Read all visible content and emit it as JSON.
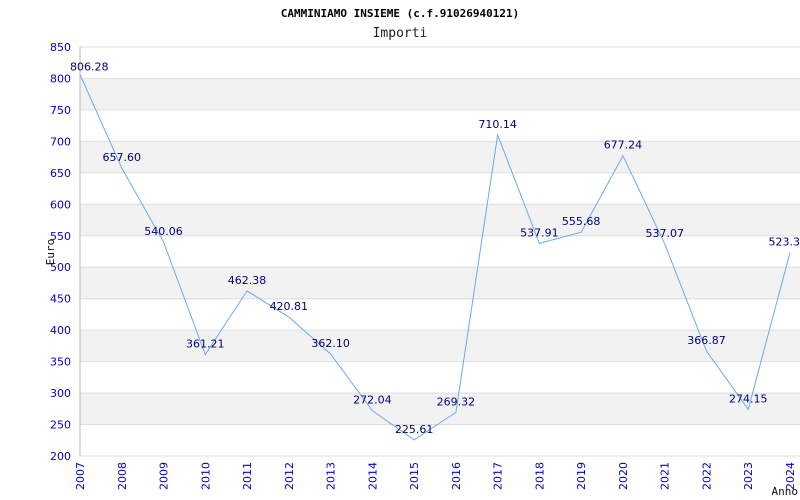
{
  "chart_data": {
    "type": "line",
    "title": "CAMMINIAMO INSIEME (c.f.91026940121)",
    "subtitle": "Importi",
    "xlabel": "Anno",
    "ylabel": "Euro",
    "categories": [
      "2007",
      "2008",
      "2009",
      "2010",
      "2011",
      "2012",
      "2013",
      "2014",
      "2015",
      "2016",
      "2017",
      "2018",
      "2019",
      "2020",
      "2021",
      "2022",
      "2023",
      "2024"
    ],
    "values": [
      806.28,
      657.6,
      540.06,
      361.21,
      462.38,
      420.81,
      362.1,
      272.04,
      225.61,
      269.32,
      710.14,
      537.91,
      555.68,
      677.24,
      537.07,
      366.87,
      274.15,
      523.3
    ],
    "value_labels": [
      "806.28",
      "657.60",
      "540.06",
      "361.21",
      "462.38",
      "420.81",
      "362.10",
      "272.04",
      "225.61",
      "269.32",
      "710.14",
      "537.91",
      "555.68",
      "677.24",
      "537.07",
      "366.87",
      "274.15",
      "523.3"
    ],
    "yticks": [
      "200",
      "250",
      "300",
      "350",
      "400",
      "450",
      "500",
      "550",
      "600",
      "650",
      "700",
      "750",
      "800",
      "850"
    ],
    "ylim": [
      200,
      850
    ],
    "grid": true,
    "colors": {
      "line": "#6aaaee",
      "band": "#f2f2f2",
      "grid": "#dddddd",
      "tick": "#0000cc",
      "label": "#000080"
    }
  }
}
